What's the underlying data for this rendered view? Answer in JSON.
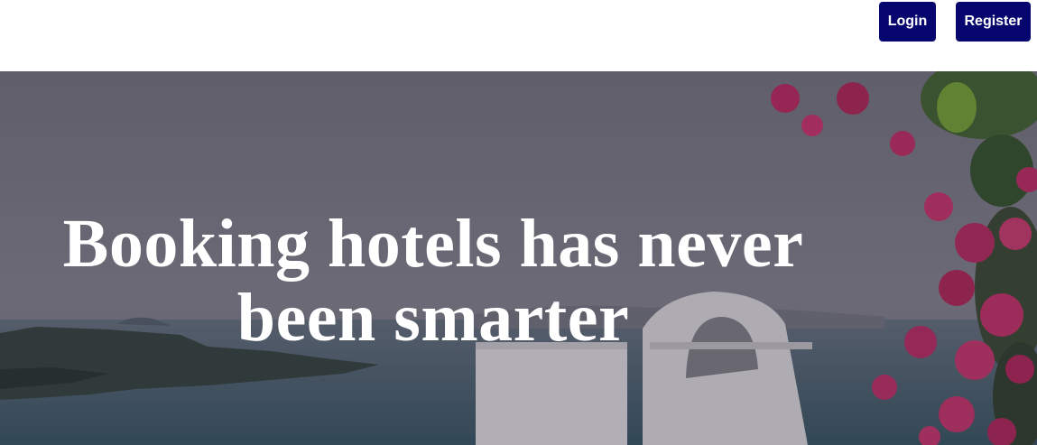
{
  "header": {
    "login_label": "Login",
    "register_label": "Register",
    "button_color": "#06066e"
  },
  "hero": {
    "headline": "Booking hotels has never been smarter",
    "image": "seaside-terrace-with-bougainvillea",
    "overlay_color": "#5a5a66"
  }
}
